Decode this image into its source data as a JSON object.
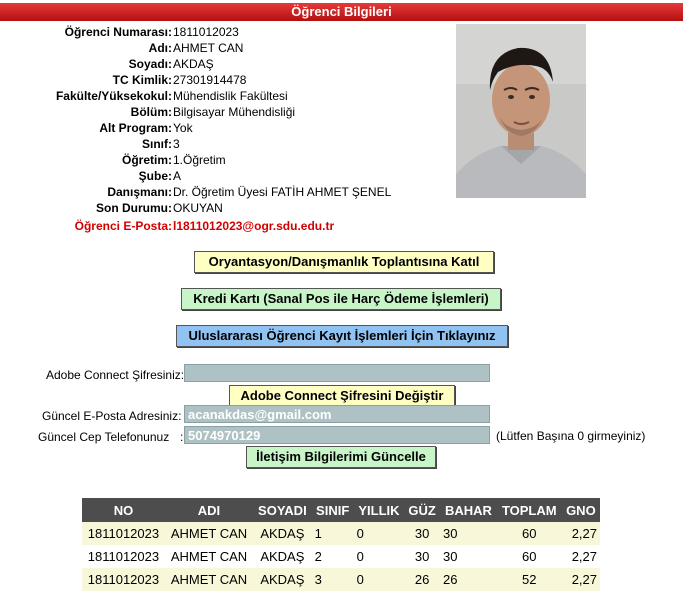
{
  "header": {
    "title": "Öğrenci Bilgileri"
  },
  "student": {
    "fields": [
      {
        "label": "Öğrenci Numarası",
        "value": "1811012023"
      },
      {
        "label": "Adı",
        "value": "AHMET CAN"
      },
      {
        "label": "Soyadı",
        "value": "AKDAŞ"
      },
      {
        "label": "TC Kimlik",
        "value": "27301914478"
      },
      {
        "label": "Fakülte/Yüksekokul",
        "value": "Mühendislik Fakültesi"
      },
      {
        "label": "Bölüm",
        "value": "Bilgisayar Mühendisliği"
      },
      {
        "label": "Alt Program",
        "value": "Yok"
      },
      {
        "label": "Sınıf",
        "value": "3"
      },
      {
        "label": "Öğretim",
        "value": "1.Öğretim"
      },
      {
        "label": "Şube",
        "value": "A"
      },
      {
        "label": "Danışmanı",
        "value": "Dr. Öğretim Üyesi FATİH AHMET ŞENEL"
      },
      {
        "label": "Son Durumu",
        "value": "OKUYAN"
      }
    ],
    "email_label": "Öğrenci E-Posta",
    "email_value": "l1811012023@ogr.sdu.edu.tr"
  },
  "buttons": {
    "orientation": "Oryantasyon/Danışmanlık Toplantısına Katıl",
    "credit_card": "Kredi Kartı (Sanal Pos ile Harç Ödeme İşlemleri)",
    "international": "Uluslararası Öğrenci Kayıt İşlemleri İçin Tıklayınız",
    "adobe_change": "Adobe Connect Şifresini Değiştir",
    "update_contact": "İletişim Bilgilerimi Güncelle"
  },
  "form": {
    "adobe_label": "Adobe Connect Şifresiniz:",
    "adobe_value": "",
    "email_label": "Güncel E-Posta Adresiniz:",
    "email_value": "acanakdas@gmail.com",
    "phone_label": "Güncel Cep Telefonunuz",
    "phone_colon": ":",
    "phone_value": "5074970129",
    "phone_hint": "(Lütfen Başına 0 girmeyiniz)"
  },
  "grades": {
    "headers": [
      "NO",
      "ADI",
      "SOYADI",
      "SINIF",
      "YILLIK",
      "GÜZ",
      "BAHAR",
      "TOPLAM",
      "GNO"
    ],
    "rows": [
      [
        "1811012023",
        "AHMET CAN",
        "AKDAŞ",
        "1",
        "0",
        "30",
        "30",
        "60",
        "2,27"
      ],
      [
        "1811012023",
        "AHMET CAN",
        "AKDAŞ",
        "2",
        "0",
        "30",
        "30",
        "60",
        "2,27"
      ],
      [
        "1811012023",
        "AHMET CAN",
        "AKDAŞ",
        "3",
        "0",
        "26",
        "26",
        "52",
        "2,27"
      ]
    ]
  },
  "colors": {
    "title_bar": "#c41e1e",
    "email_highlight": "#d40000",
    "table_header": "#4d4d4d"
  }
}
